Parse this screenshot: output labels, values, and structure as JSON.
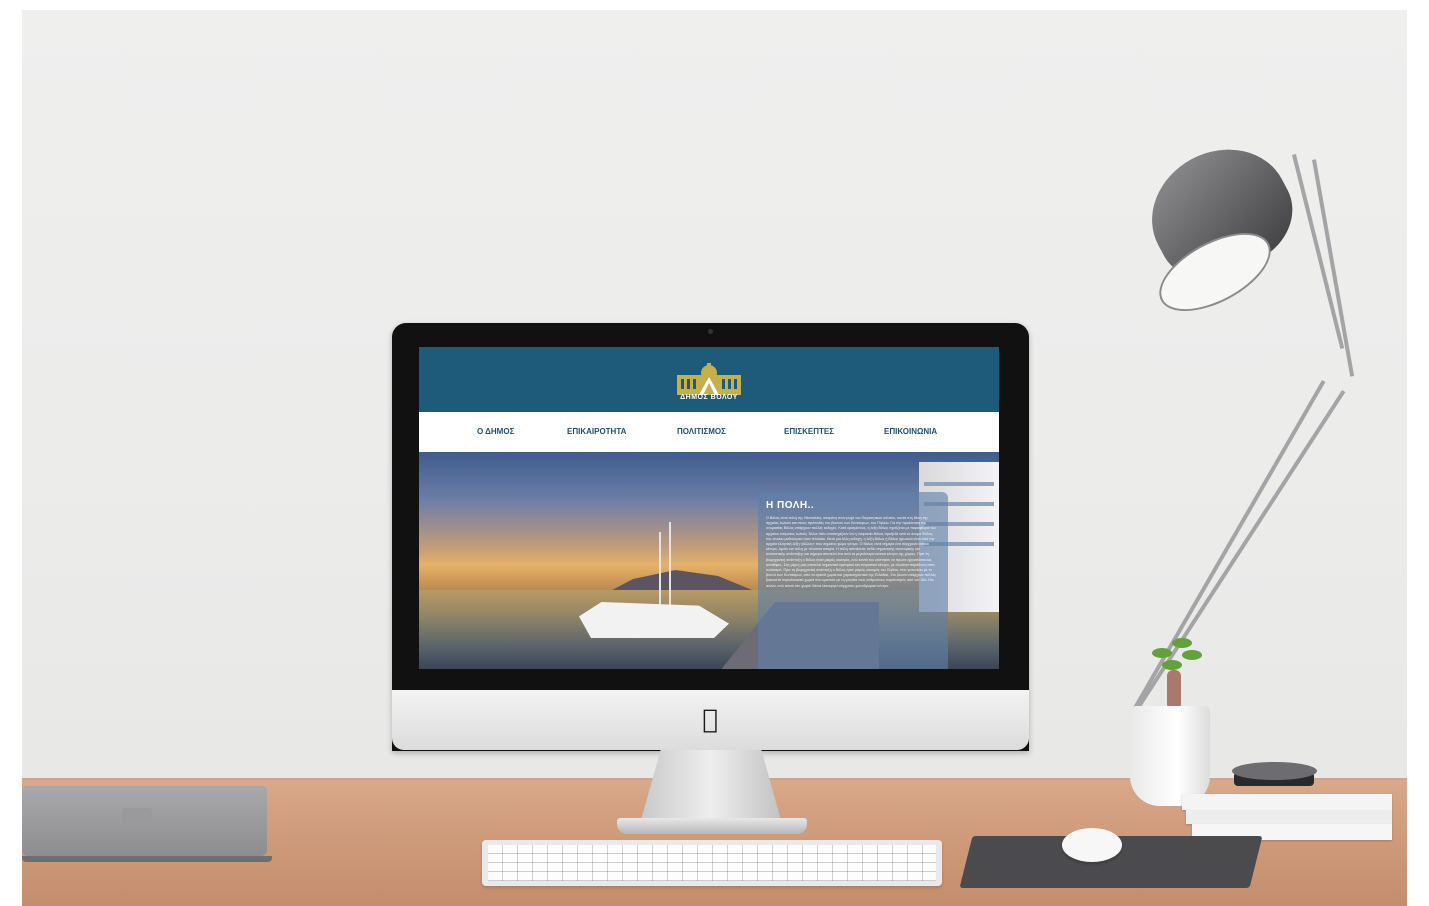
{
  "site": {
    "logo_text": "ΔΗΜΟΣ ΒΟΛΟΥ",
    "nav": [
      {
        "label": "Ο ΔΗΜΟΣ"
      },
      {
        "label": "ΕΠΙΚΑΙΡΟΤΗΤΑ"
      },
      {
        "label": "ΠΟΛΙΤΙΣΜΟΣ"
      },
      {
        "label": "ΕΠΙΣΚΕΠΤΕΣ"
      },
      {
        "label": "ΕΠΙΚΟΙΝΩΝΙΑ"
      }
    ],
    "hero_panel": {
      "title": "Η ΠΟΛΗ..",
      "body": "Ο Βόλος είναι πόλη της Θεσσαλίας, κτισμένη στον μυχό του Παγασητικού κόλπου, κοντά στη θέση της αρχαίας Ιωλκού και στους πρόποδες του βουνού των Κενταύρων, του Πηλίου. Για την προέλευση της ονομασίας Βόλος υπάρχουν πολλές εκδοχές. Κατά ορισμένους, η λέξη Βόλος σχετίζεται με παραφθορά του αρχαίου ονόματος Ιωλκός. Άλλοι πάλι υποστηρίζουν ότι η ονομασία Βόλος προήλθε από το όνομα Φόλος, του οποίου μυθολογικό ήταν πλούσιο. Κατά μια άλλη εκδοχή, η λέξη Βόλος ή Βόλος ηρωικού είναι από την αρχαία ελληνική λέξη «βώλος» που σημαίνει χώμα γόνιμο. Ο Βόλος είναι σήμερα ένα σύγχρονο αστικό κέντρο, λιμάνι και πόλη με πλούσια ιστορία. Η πόλη αποτέλεσε πεδίο σημαντικής οικονομικής και πολιτιστικής ανάπτυξης και σήμερα αποτελεί ένα από τα μεγαλύτερα αστικά κέντρα της χώρας. Πριν τη βιομηχανική ανάπτυξη ο Βόλος ήταν μικρός οικισμός, ενώ κοντά του κτίστηκαν τα πρώτα εργοστάσια και αποθήκες. Στις μέρες μας αποτελεί σημαντικό εμπορικό και τουριστικό κέντρο, με πλούσια παράδοση στον πολιτισμό. Πριν τη βιομηχανική ανάπτυξη ο Βόλος ήταν μικρός οικισμός του Πηλίου, που γειτονεύει με το βουνό των Κενταύρων, από τα ορεινά χωριά και χαρακτηριστικά της Ελλάδας. Στο βουνό υπάρχουν πολλές ξακουστά παραδοσιακά χωριά που κρατούν με τη γοητεία τους ανθρώπους περιπατητές από τον 18ο-19ο αιώνα, ενώ κοντά στο χωριό Χάνια λειτουργεί σύγχρονο χιονοδρομικό κέντρο."
    }
  },
  "colors": {
    "header_blue": "#1e5a7a",
    "nav_text": "#1e5073",
    "logo_gold": "#c7b04a",
    "panel_overlay": "#6080a8"
  }
}
